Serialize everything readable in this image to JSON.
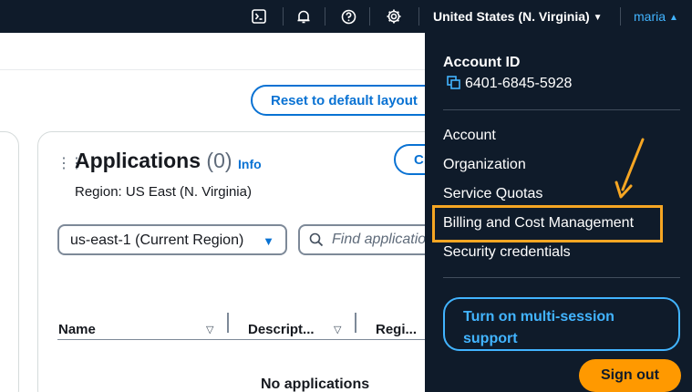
{
  "topnav": {
    "icons": [
      "cloudshell-icon",
      "bell-icon",
      "help-icon",
      "gear-icon"
    ],
    "region": "United States (N. Virginia)",
    "user": "maria"
  },
  "main": {
    "reset_button": "Reset to default layout",
    "widget": {
      "title": "Applications",
      "count": "(0)",
      "info": "Info",
      "create_button": "Create application",
      "region_text": "Region: US East (N. Virginia)",
      "region_select": "us-east-1 (Current Region)",
      "search_placeholder": "Find applications",
      "columns": [
        "Name",
        "Descript...",
        "Regi..."
      ],
      "empty_text": "No applications"
    }
  },
  "account_menu": {
    "account_id_label": "Account ID",
    "account_id": "6401-6845-5928",
    "items": [
      "Account",
      "Organization",
      "Service Quotas",
      "Billing and Cost Management",
      "Security credentials"
    ],
    "multi_session_button": "Turn on multi-session support",
    "sign_out_button": "Sign out"
  },
  "colors": {
    "nav_bg": "#0f1b2a",
    "link_blue": "#0972d3",
    "menu_link_blue": "#42b4ff",
    "highlight_orange": "#f6a623",
    "signout_orange": "#ff9900"
  }
}
